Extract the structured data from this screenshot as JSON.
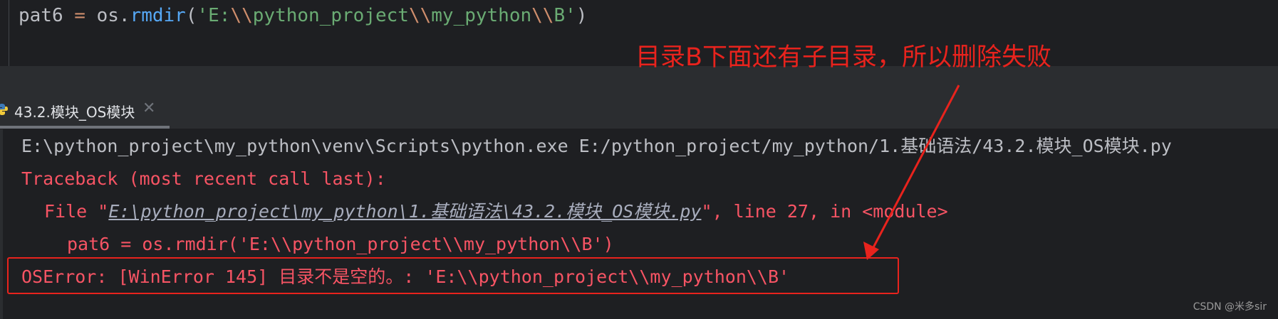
{
  "editor": {
    "code_parts": {
      "var": "pat6",
      "op": " = ",
      "obj": "os.",
      "fn": "rmdir",
      "open": "(",
      "q1": "'E:",
      "e1": "\\\\",
      "s1": "python_project",
      "e2": "\\\\",
      "s2": "my_python",
      "e3": "\\\\",
      "s3": "B'",
      "close": ")"
    }
  },
  "annotation": {
    "text": "目录B下面还有子目录，所以删除失败",
    "color": "#e8231d"
  },
  "run_tab": {
    "icon": "python-icon",
    "label": "43.2.模块_OS模块",
    "close": "✕"
  },
  "console": {
    "cmd": "E:\\python_project\\my_python\\venv\\Scripts\\python.exe E:/python_project/my_python/1.基础语法/43.2.模块_OS模块.py",
    "traceback": "Traceback (most recent call last):",
    "file_prefix": "File \"",
    "file_link": "E:\\python_project\\my_python\\1.基础语法\\43.2.模块_OS模块.py",
    "file_suffix": "\", line 27, in <module>",
    "code_line": "pat6 = os.rmdir('E:\\\\python_project\\\\my_python\\\\B')",
    "error": "OSError: [WinError 145] 目录不是空的。: 'E:\\\\python_project\\\\my_python\\\\B'"
  },
  "watermark": "CSDN @米多sir"
}
